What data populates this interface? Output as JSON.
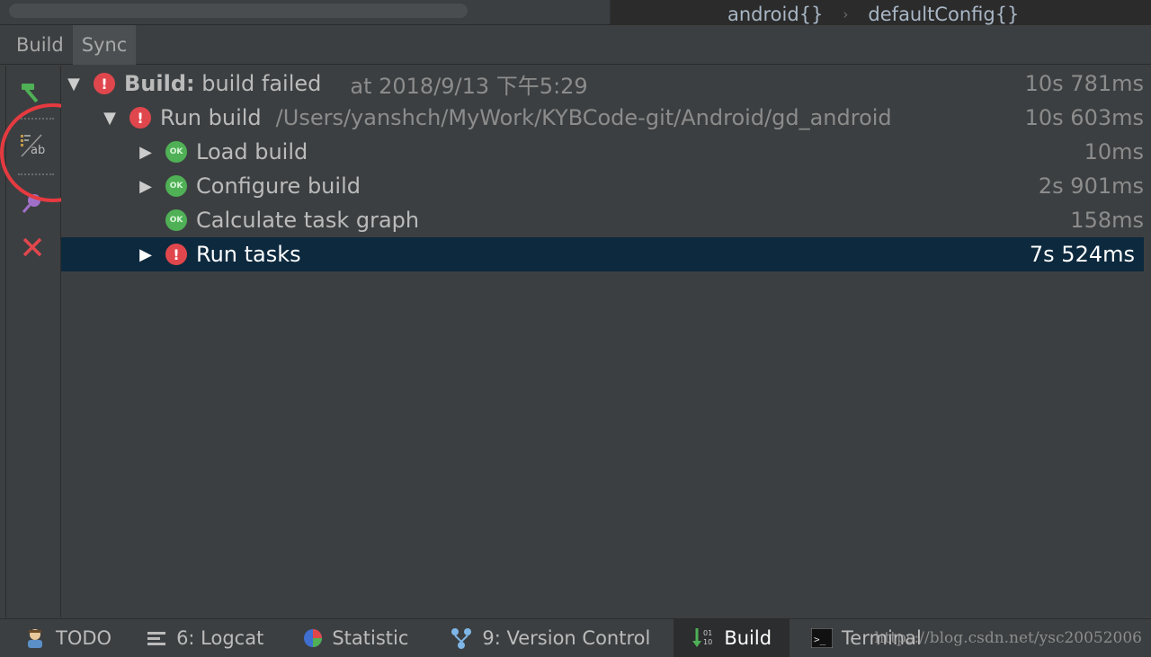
{
  "editor": {
    "crumbs": [
      "android{}",
      "defaultConfig{}"
    ],
    "crumb_separator": "›"
  },
  "tabs": [
    "Build",
    "Sync"
  ],
  "left_toolbar": {
    "icons": [
      "hammer-icon",
      "toggle-view-icon",
      "pin-icon",
      "close-icon"
    ],
    "highlight_color": "#e63a40"
  },
  "tree": [
    {
      "expanded": true,
      "status": "error",
      "label_bold": "Build:",
      "label": " build failed",
      "extra": "at 2018/9/13 下午5:29",
      "duration": "10s 781ms"
    },
    {
      "expanded": true,
      "status": "error",
      "label": "Run build",
      "extra": "/Users/yanshch/MyWork/KYBCode-git/Android/gd_android",
      "duration": "10s 603ms"
    },
    {
      "expanded": false,
      "status": "ok",
      "label": "Load build",
      "duration": "10ms"
    },
    {
      "expanded": false,
      "status": "ok",
      "label": "Configure build",
      "duration": "2s 901ms"
    },
    {
      "status": "ok",
      "label": "Calculate task graph",
      "duration": "158ms"
    },
    {
      "expanded": false,
      "status": "error",
      "label": "Run tasks",
      "duration": "7s 524ms",
      "selected": true
    }
  ],
  "status_icons": {
    "error": "!",
    "ok": "OK"
  },
  "bottom_bar": [
    {
      "icon": "todo-icon",
      "label": "TODO"
    },
    {
      "icon": "logcat-icon",
      "label": "6: Logcat"
    },
    {
      "icon": "statistic-icon",
      "label": "Statistic"
    },
    {
      "icon": "version-control-icon",
      "label": "9: Version Control"
    },
    {
      "icon": "build-icon",
      "label": "Build",
      "active": true
    },
    {
      "icon": "terminal-icon",
      "label": "Terminal"
    }
  ],
  "watermark": "https://blog.csdn.net/ysc20052006",
  "colors": {
    "selected_row": "#0d293e",
    "error": "#e0474d",
    "ok": "#4fb056"
  }
}
